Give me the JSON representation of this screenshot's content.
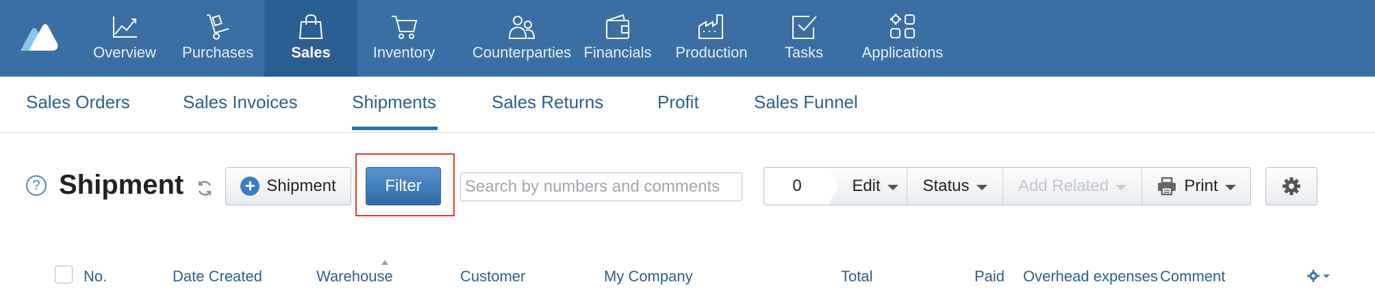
{
  "topnav": {
    "items": [
      {
        "label": "Overview",
        "icon": "chart-line-icon"
      },
      {
        "label": "Purchases",
        "icon": "hand-truck-icon"
      },
      {
        "label": "Sales",
        "icon": "shopping-bag-icon",
        "active": true
      },
      {
        "label": "Inventory",
        "icon": "cart-icon"
      },
      {
        "label": "Counterparties",
        "icon": "people-icon"
      },
      {
        "label": "Financials",
        "icon": "wallet-icon"
      },
      {
        "label": "Production",
        "icon": "factory-icon"
      },
      {
        "label": "Tasks",
        "icon": "checkbox-icon"
      },
      {
        "label": "Applications",
        "icon": "apps-grid-icon"
      }
    ],
    "colors": {
      "background": "#3b6fa3",
      "active": "#2c5f91"
    }
  },
  "subnav": {
    "items": [
      {
        "label": "Sales Orders"
      },
      {
        "label": "Sales Invoices"
      },
      {
        "label": "Shipments",
        "active": true
      },
      {
        "label": "Sales Returns"
      },
      {
        "label": "Profit"
      },
      {
        "label": "Sales Funnel"
      }
    ]
  },
  "toolbar": {
    "help_label": "?",
    "title": "Shipment",
    "add_label": "Shipment",
    "filter_label": "Filter",
    "search_placeholder": "Search by numbers and comments",
    "selected_count": "0",
    "edit_label": "Edit",
    "status_label": "Status",
    "add_related_label": "Add Related",
    "print_label": "Print"
  },
  "table": {
    "columns": [
      "No.",
      "Date Created",
      "Warehouse",
      "Customer",
      "My Company",
      "Total",
      "Paid",
      "Overhead expenses",
      "Comment"
    ],
    "sorted_column": "Warehouse"
  }
}
